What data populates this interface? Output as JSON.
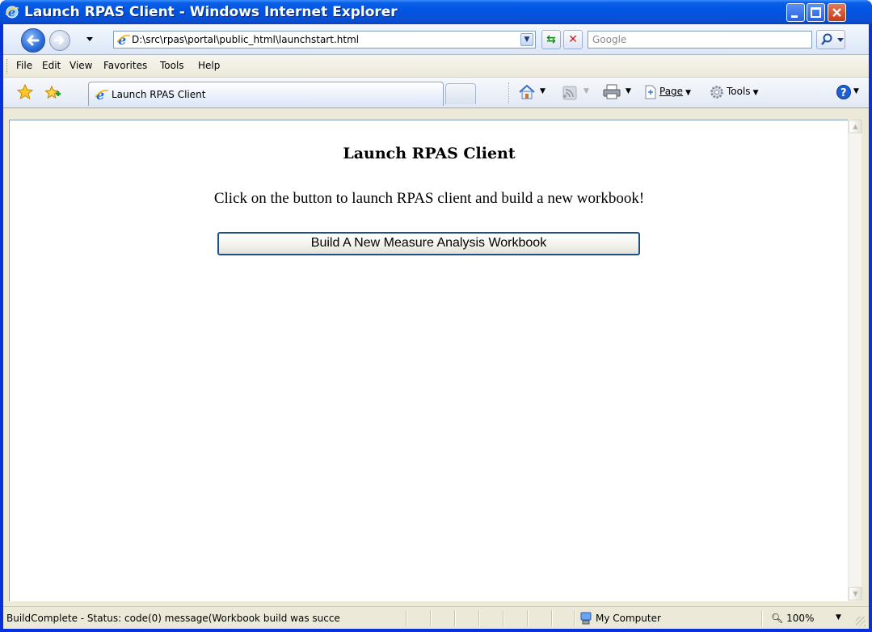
{
  "window": {
    "title": "Launch RPAS Client - Windows Internet Explorer"
  },
  "address_bar": {
    "url": "D:\\src\\rpas\\portal\\public_html\\launchstart.html"
  },
  "search_box": {
    "placeholder": "Google"
  },
  "menu": {
    "items": [
      {
        "label": "File"
      },
      {
        "label": "Edit"
      },
      {
        "label": "View"
      },
      {
        "label": "Favorites"
      },
      {
        "label": "Tools"
      },
      {
        "label": "Help"
      }
    ]
  },
  "tab": {
    "label": "Launch RPAS Client"
  },
  "command_bar": {
    "page_label": "Page",
    "tools_label": "Tools"
  },
  "page": {
    "heading": "Launch RPAS Client",
    "instruction": "Click on the button to launch RPAS client and build a new workbook!",
    "button_label": "Build A New Measure Analysis Workbook"
  },
  "status_bar": {
    "message": "BuildComplete - Status: code(0) message(Workbook build was succe",
    "zone": "My Computer",
    "zoom": "100%"
  },
  "colors": {
    "titlebar": "#0054e3",
    "button_border": "#1f4f86"
  }
}
